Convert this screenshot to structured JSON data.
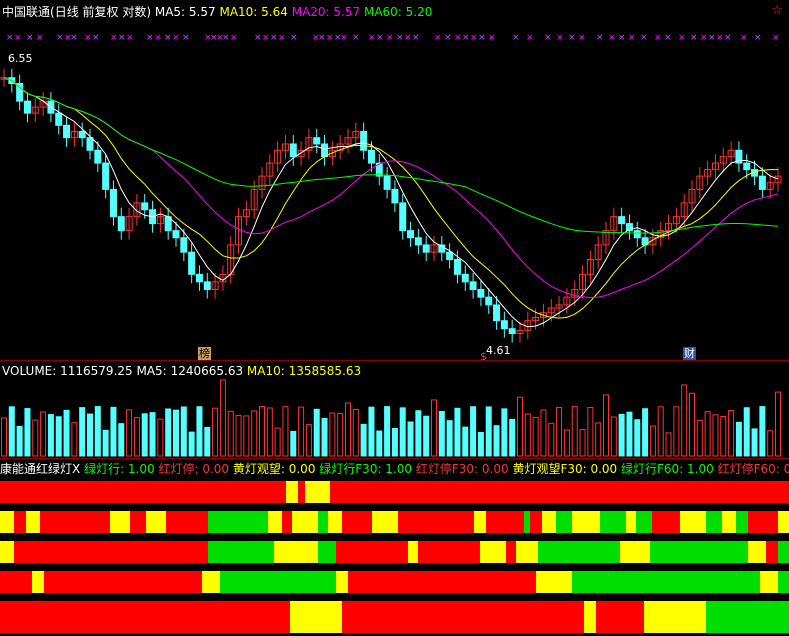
{
  "header": {
    "stock_name": "中国联通",
    "period": "(日线 前复权 对数)",
    "ma5_label": "MA5:",
    "ma5_value": "5.57",
    "ma10_label": "MA10:",
    "ma10_value": "5.64",
    "ma20_label": "MA20:",
    "ma20_value": "5.57",
    "ma60_label": "MA60:",
    "ma60_value": "5.20"
  },
  "price_panel": {
    "high_label": "6.55",
    "low_label": "4.61",
    "marker_bang": "榜",
    "marker_cai": "财",
    "marker_s": "$"
  },
  "volume_header": {
    "volume_label": "VOLUME:",
    "volume_value": "1116579.25",
    "ma5_label": "MA5:",
    "ma5_value": "1240665.63",
    "ma10_label": "MA10:",
    "ma10_value": "1358585.63"
  },
  "indicator_header": {
    "name": "康能通红绿灯X",
    "green_run": "绿灯行: 1.00",
    "red_stop": "红灯停: 0.00",
    "yellow_watch": "黄灯观望: 0.00",
    "green_run_f30": "绿灯行F30: 1.00",
    "red_stop_f30": "红灯停F30: 0.00",
    "yellow_watch_f30": "黄灯观望F30: 0.00",
    "green_run_f60": "绿灯行F60: 1.00",
    "red_stop_f60": "红灯停F60: 0"
  },
  "colors": {
    "up": "#ff3232",
    "down": "#54ffff",
    "ma5": "#ffffff",
    "ma10": "#ffff00",
    "ma20": "#ff00ff",
    "ma60": "#00ff00",
    "red_light": "#ff0000",
    "green_light": "#00dd00",
    "yellow_light": "#ffff00"
  },
  "light_rows": [
    [
      "R",
      "R",
      "R",
      "R",
      "R",
      "R",
      "R",
      "R",
      "R",
      "R",
      "R",
      "R",
      "R",
      "R",
      "R",
      "R",
      "R",
      "R",
      "R",
      "R",
      "R",
      "R",
      "R",
      "R",
      "R",
      "R",
      "R",
      "R",
      "R",
      "R",
      "R",
      "R",
      "R",
      "R",
      "R",
      "R",
      "R",
      "R",
      "R",
      "R",
      "R",
      "R",
      "R",
      "R",
      "R",
      "R",
      "R",
      "R",
      "R",
      "R",
      "R",
      "R",
      "R",
      "R",
      "R",
      "R",
      "R",
      "R",
      "R",
      "R",
      "R",
      "R",
      "R",
      "R",
      "R",
      "R",
      "R",
      "R",
      "R",
      "R",
      "R",
      "R",
      "R",
      "R",
      "R",
      "R",
      "R",
      "R",
      "R",
      "R",
      "R",
      "R",
      "R",
      "R",
      "R",
      "R",
      "R",
      "R",
      "R",
      "R",
      "R",
      "R",
      "R",
      "R",
      "R",
      "R",
      "R",
      "R",
      "R",
      "R",
      "R",
      "R",
      "R",
      "R",
      "R",
      "R",
      "R",
      "R",
      "R",
      "R",
      "R",
      "R",
      "R",
      "R",
      "R",
      "R",
      "R",
      "R",
      "R",
      "R",
      "R",
      "R",
      "R",
      "R",
      "R",
      "R",
      "R",
      "R",
      "R",
      "R",
      "R",
      "R",
      "R",
      "R",
      "R",
      "R",
      "R",
      "R",
      "R",
      "R",
      "R",
      "R",
      "R",
      "R",
      "R",
      "R",
      "R",
      "R",
      "R",
      "R",
      "R",
      "R",
      "R",
      "R",
      "R",
      "R",
      "R",
      "R",
      "R",
      "R",
      "R",
      "R",
      "R",
      "R",
      "R",
      "R",
      "R",
      "R",
      "R",
      "R",
      "R",
      "R",
      "R",
      "R",
      "R",
      "R",
      "R",
      "R",
      "R",
      "R",
      "R",
      "R",
      "R",
      "R",
      "R",
      "R",
      "R",
      "R",
      "R",
      "R",
      "R",
      "R",
      "R",
      "R",
      "R",
      "R",
      "R",
      "R",
      "R",
      "R"
    ],
    [],
    [],
    [],
    []
  ]
}
